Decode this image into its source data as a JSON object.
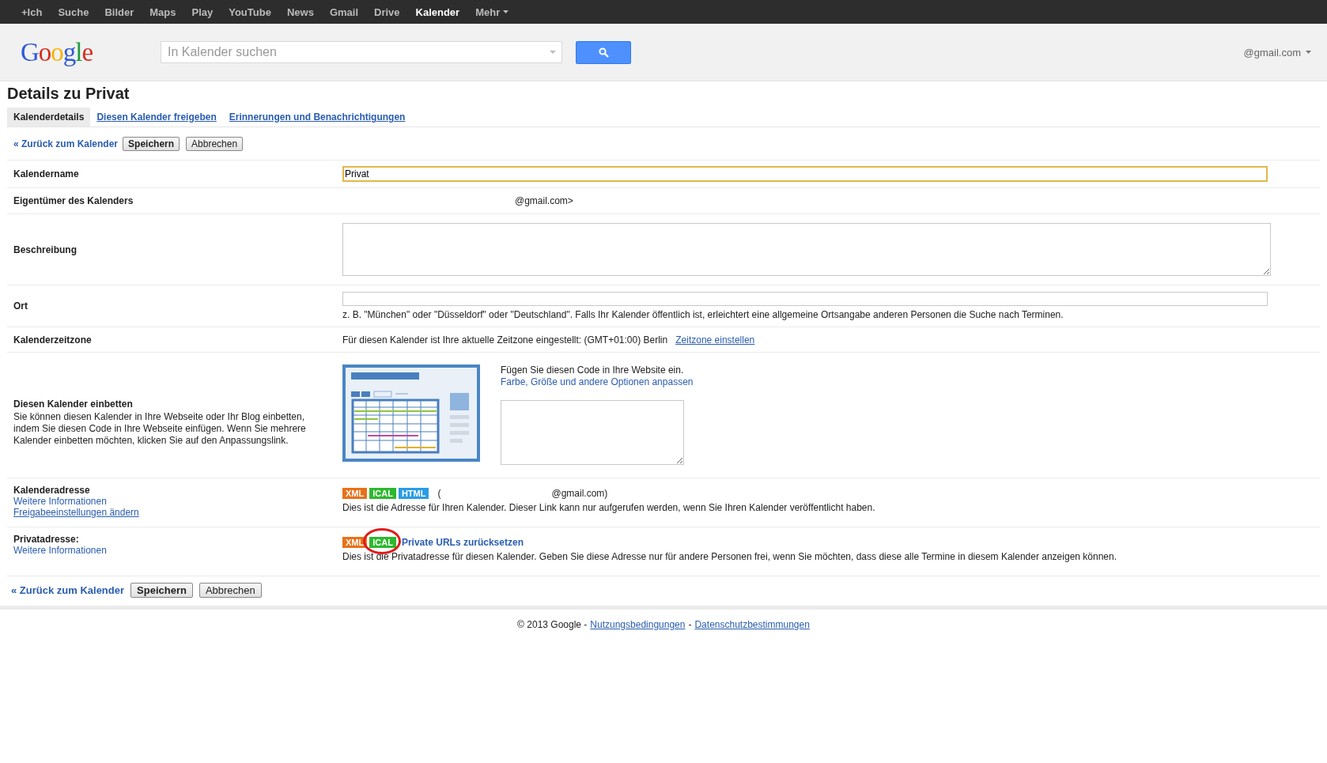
{
  "top_nav": [
    {
      "label": "+Ich",
      "selected": false,
      "kind": "link"
    },
    {
      "label": "Suche",
      "selected": false,
      "kind": "link"
    },
    {
      "label": "Bilder",
      "selected": false,
      "kind": "link"
    },
    {
      "label": "Maps",
      "selected": false,
      "kind": "link"
    },
    {
      "label": "Play",
      "selected": false,
      "kind": "link"
    },
    {
      "label": "YouTube",
      "selected": false,
      "kind": "link"
    },
    {
      "label": "News",
      "selected": false,
      "kind": "link"
    },
    {
      "label": "Gmail",
      "selected": false,
      "kind": "link"
    },
    {
      "label": "Drive",
      "selected": false,
      "kind": "link"
    },
    {
      "label": "Kalender",
      "selected": true,
      "kind": "link"
    },
    {
      "label": "Mehr",
      "selected": false,
      "kind": "menu"
    }
  ],
  "header": {
    "logo": "Google",
    "search": {
      "placeholder": "In Kalender suchen"
    },
    "account": "@gmail.com"
  },
  "page_title": "Details zu Privat",
  "tabs": [
    {
      "label": "Kalenderdetails",
      "selected": true
    },
    {
      "label": "Diesen Kalender freigeben",
      "selected": false
    },
    {
      "label": "Erinnerungen und Benachrichtigungen",
      "selected": false
    }
  ],
  "top_actions": {
    "back": "« Zurück zum Kalender",
    "save": "Speichern",
    "cancel": "Abbrechen"
  },
  "rows": [
    {
      "kind": "text-input",
      "label": "Kalendername",
      "value": "Privat",
      "focused": true
    },
    {
      "kind": "text",
      "label": "Eigentümer des Kalenders",
      "value": "@gmail.com>"
    },
    {
      "kind": "textarea",
      "label": "Beschreibung"
    },
    {
      "kind": "input-hint",
      "label": "Ort",
      "hint": "z. B. \"München\" oder \"Düsseldorf\" oder \"Deutschland\". Falls Ihr Kalender öffentlich ist, erleichtert eine allgemeine Ortsangabe anderen Personen die Suche nach Terminen."
    },
    {
      "kind": "timezone",
      "label": "Kalenderzeitzone",
      "text": "Für diesen Kalender ist Ihre aktuelle Zeitzone eingestellt:  (GMT+01:00) Berlin",
      "link": "Zeitzone einstellen"
    },
    {
      "kind": "embed",
      "label": "Diesen Kalender einbetten",
      "description": "Sie können diesen Kalender in Ihre Webseite oder Ihr Blog einbetten, indem Sie diesen Code in Ihre Webseite einfügen. Wenn Sie mehrere Kalender einbetten möchten, klicken Sie auf den Anpassungslink.",
      "instruction": "Fügen Sie diesen Code in Ihre Website ein.",
      "link": "Farbe, Größe und andere Optionen anpassen"
    },
    {
      "kind": "address",
      "label": "Kalenderadresse",
      "links": [
        "Weitere Informationen",
        "Freigabeeinstellungen ändern"
      ],
      "badges": [
        {
          "label": "XML",
          "color": "#e8711a",
          "highlighted": false
        },
        {
          "label": "ICAL",
          "color": "#2eb82e",
          "highlighted": false
        },
        {
          "label": "HTML",
          "color": "#2b9be3",
          "highlighted": false
        }
      ],
      "address_start": "(",
      "address_end": "@gmail.com)",
      "note": "Dies ist die Adresse für Ihren Kalender. Dieser Link kann nur aufgerufen werden, wenn Sie Ihren Kalender veröffentlicht haben."
    },
    {
      "kind": "address",
      "label": "Privatadresse:",
      "links": [
        "Weitere Informationen"
      ],
      "badges": [
        {
          "label": "XML",
          "color": "#e8711a",
          "highlighted": false
        },
        {
          "label": "ICAL",
          "color": "#2eb82e",
          "highlighted": true
        }
      ],
      "action_link": "Private URLs zurücksetzen",
      "note": "Dies ist die Privatadresse für diesen Kalender. Geben Sie diese Adresse nur für andere Personen frei, wenn Sie möchten, dass diese alle Termine in diesem Kalender anzeigen können."
    }
  ],
  "bottom_actions": {
    "back": "« Zurück zum Kalender",
    "save": "Speichern",
    "cancel": "Abbrechen"
  },
  "footer": {
    "copyright": "© 2013 Google -",
    "links": [
      "Nutzungsbedingungen",
      "Datenschutzbestimmungen"
    ],
    "separator": "-"
  }
}
